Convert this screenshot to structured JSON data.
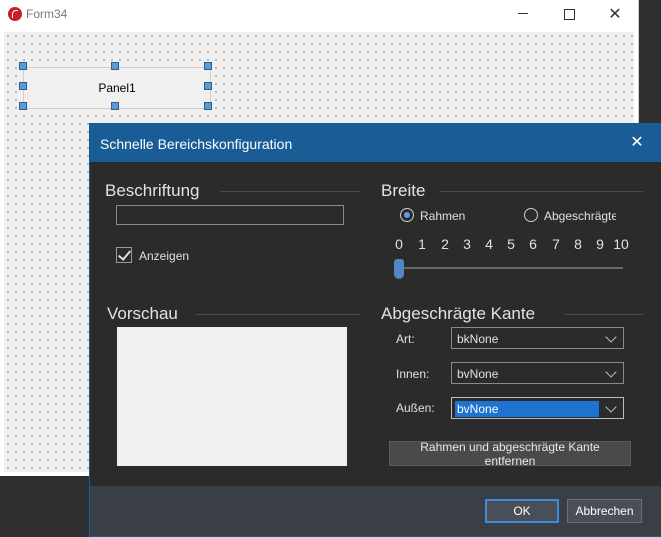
{
  "form": {
    "title": "Form34",
    "panel_label": "Panel1",
    "close_glyph": "✕"
  },
  "dialog": {
    "title": "Schnelle Bereichskonfiguration",
    "close_glyph": "✕",
    "caption": {
      "title": "Beschriftung",
      "input_value": "",
      "show_label": "Anzeigen",
      "show_checked": true
    },
    "preview": {
      "title": "Vorschau"
    },
    "width": {
      "title": "Breite",
      "radio_frame": "Rahmen",
      "radio_bevel": "Abgeschrägte",
      "selected": "Rahmen",
      "ticks": [
        "0",
        "1",
        "2",
        "3",
        "4",
        "5",
        "6",
        "7",
        "8",
        "9",
        "10"
      ],
      "value": 0
    },
    "bevel": {
      "title": "Abgeschrägte Kante",
      "art_label": "Art:",
      "art_value": "bkNone",
      "inner_label": "Innen:",
      "inner_value": "bvNone",
      "outer_label": "Außen:",
      "outer_value": "bvNone"
    },
    "remove_button": "Rahmen und abgeschrägte Kante entfernen",
    "ok_button": "OK",
    "cancel_button": "Abbrechen"
  },
  "colors": {
    "dialog_title_bar": "#1a5c96",
    "dialog_body": "#2b2b2b",
    "accent": "#3d8ddb"
  },
  "icons": {
    "form": "app-logo-icon",
    "minimize": "minimize-icon",
    "maximize": "maximize-icon",
    "close": "close-icon",
    "dropdown": "chevron-down-icon"
  }
}
